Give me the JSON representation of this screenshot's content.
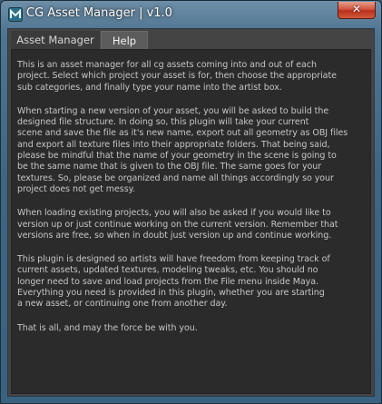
{
  "window": {
    "title": "CG Asset Manager | v1.0",
    "close_label": "✕"
  },
  "tabs": [
    {
      "label": "Asset Manager",
      "selected": false
    },
    {
      "label": "Help",
      "selected": true
    }
  ],
  "help": {
    "paragraphs": [
      [
        "This is an asset manager for all cg assets coming into and out of each",
        "project. Select which project your asset is for, then choose the appropriate",
        "sub categories, and finally type your name into the artist box."
      ],
      [
        "When starting a new version of your asset, you will be asked to build the",
        "designed file structure. In doing so, this plugin will take your current",
        "scene and save the file as it's new name, export out all geometry as OBJ files",
        "and export all texture files into their appropriate folders. That being said,",
        "please be mindful that the name of your geometry in the scene is going to",
        "be the same name that is given to the OBJ file. The same goes for your",
        "textures. So, please be organized and name all things accordingly so your",
        "project does not get messy."
      ],
      [
        "When loading existing projects, you will also be asked if you would like to",
        "version up or just continue working on the current version. Remember that",
        "versions are free, so when in doubt just version up and continue working."
      ],
      [
        "This plugin is designed so artists will have freedom from keeping track of",
        "current assets, updated textures, modeling tweaks, etc. You should no",
        "longer need to save and load projects from the File menu inside Maya.",
        "Everything you need is provided in this plugin, whether you are starting",
        "a new asset, or continuing one from another day."
      ],
      [
        "That is all, and may the force be with you."
      ]
    ]
  }
}
